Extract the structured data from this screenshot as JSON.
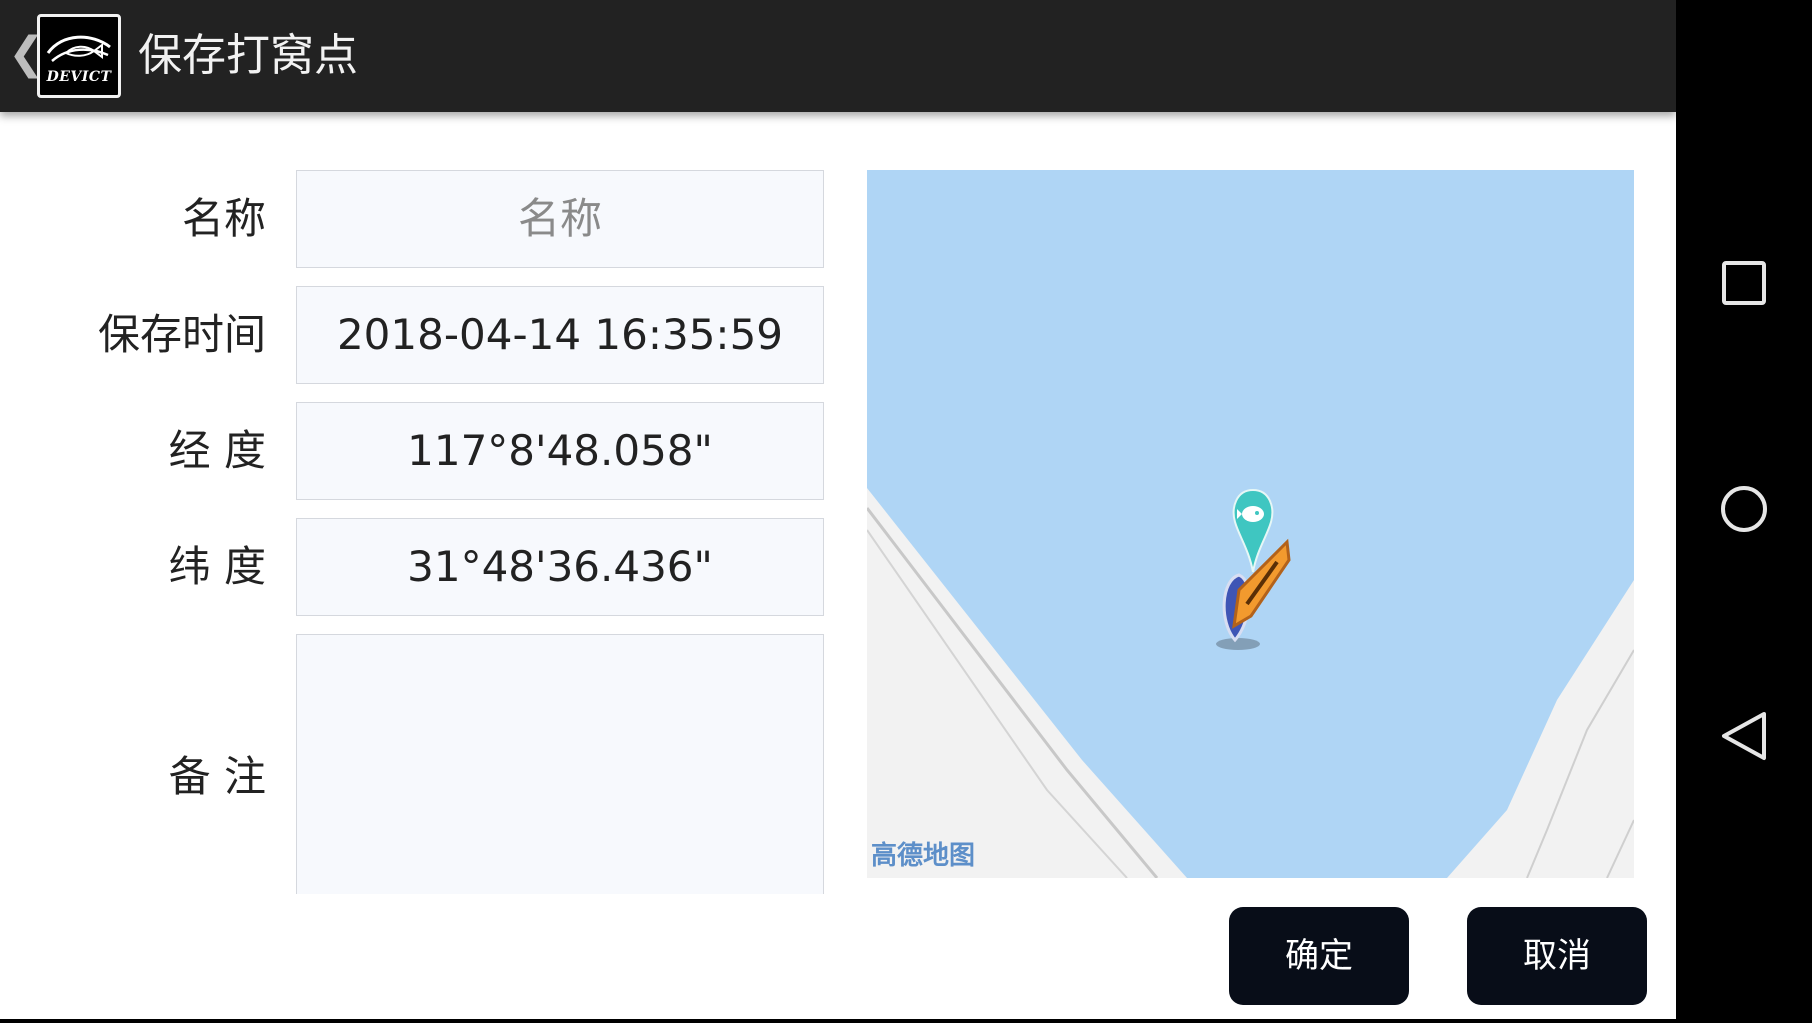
{
  "header": {
    "back_glyph": "❮",
    "logo_text": "DEVICT",
    "title": "保存打窝点"
  },
  "form": {
    "name_label": "名称",
    "name_placeholder": "名称",
    "time_label": "保存时间",
    "time_value": "2018-04-14 16:35:59",
    "longitude_label": "经 度",
    "longitude_value": "117°8'48.058\"",
    "latitude_label": "纬 度",
    "latitude_value": "31°48'36.436\"",
    "note_label": "备 注",
    "note_value": ""
  },
  "map": {
    "brand": "高德地图",
    "water_color": "#afd5f5",
    "land_color": "#f2f2f2"
  },
  "buttons": {
    "confirm": "确定",
    "cancel": "取消"
  },
  "navbar": {
    "recents_icon": "square-icon",
    "home_icon": "circle-icon",
    "back_icon": "triangle-back-icon"
  }
}
